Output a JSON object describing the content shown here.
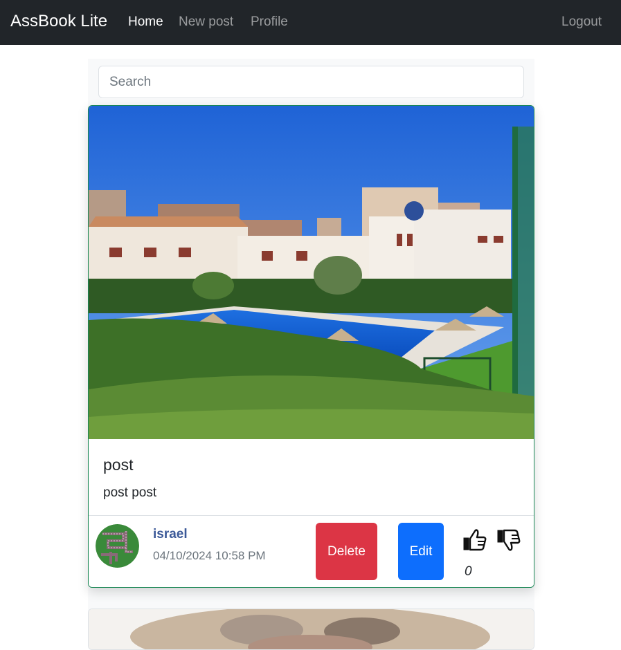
{
  "navbar": {
    "brand": "AssBook Lite",
    "links": [
      {
        "label": "Home",
        "active": true
      },
      {
        "label": "New post",
        "active": false
      },
      {
        "label": "Profile",
        "active": false
      }
    ],
    "logout_label": "Logout"
  },
  "search": {
    "placeholder": "Search",
    "value": ""
  },
  "posts": [
    {
      "image": "outdoor-pool-residential-photo",
      "title": "post",
      "body": "post post",
      "author": "israel",
      "timestamp": "04/10/2024 10:58 PM",
      "delete_label": "Delete",
      "edit_label": "Edit",
      "likes": "0",
      "like_icon": "thumbs-up-icon",
      "dislike_icon": "thumbs-down-icon"
    },
    {
      "image": "person-with-hat-photo"
    }
  ],
  "colors": {
    "navbar_bg": "#212529",
    "card_border": "#198754",
    "delete_bg": "#dc3545",
    "edit_bg": "#0d6efd",
    "author_link": "#3b5998"
  }
}
